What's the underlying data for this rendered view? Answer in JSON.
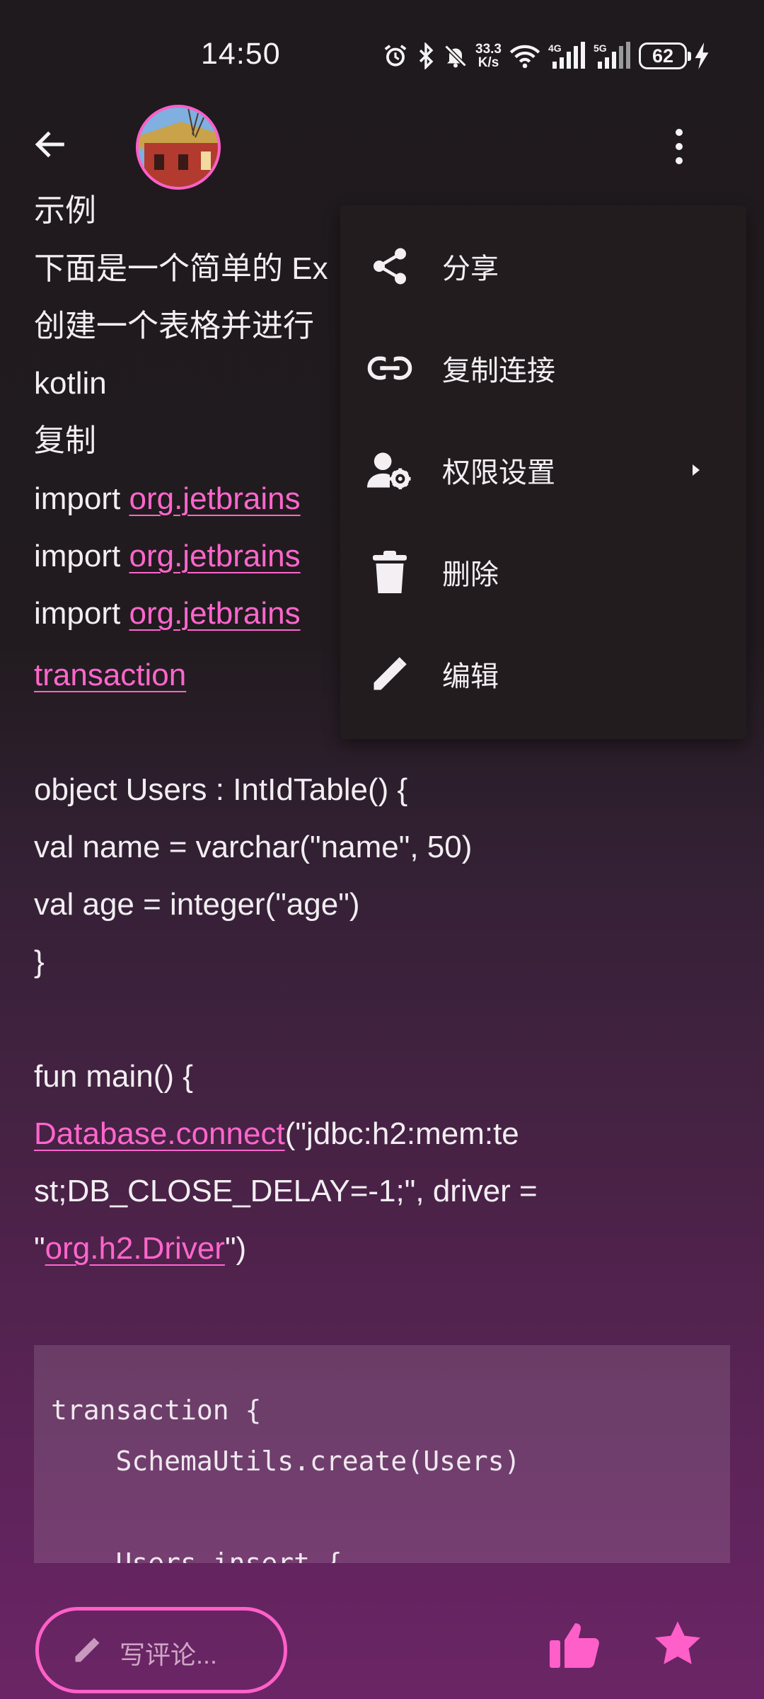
{
  "status_bar": {
    "time": "14:50",
    "net_speed_value": "33.3",
    "net_speed_unit": "K/s",
    "mobile_4g": "4G",
    "mobile_5g": "5G",
    "battery_level": "62"
  },
  "content": {
    "lines": {
      "l1": "示例",
      "l2": "下面是一个简单的 Ex",
      "l3": "创建一个表格并进行",
      "l4": "kotlin",
      "l5": "复制",
      "import_kw": "import ",
      "import_link": "org.jetbrains",
      "transaction": "transaction",
      "obj1": "object Users : IntIdTable() {",
      "obj2": "val name = varchar(\"name\", 50)",
      "obj3": "val age = integer(\"age\")",
      "obj4": "}",
      "fun1": "fun main() {",
      "db_link": "Database.connect",
      "db_rest": "(\"jdbc:h2:mem:te",
      "db2": "st;DB_CLOSE_DELAY=-1;\", driver =",
      "drv_open": "\"",
      "drv_link": "org.h2.Driver",
      "drv_close": "\")"
    },
    "code_block": [
      "transaction {",
      "    SchemaUtils.create(Users)",
      "",
      "    Users.insert {"
    ]
  },
  "menu": {
    "items": [
      {
        "label": "分享",
        "icon": "share-icon"
      },
      {
        "label": "复制连接",
        "icon": "link-icon"
      },
      {
        "label": "权限设置",
        "icon": "user-settings-icon"
      },
      {
        "label": "删除",
        "icon": "delete-icon"
      },
      {
        "label": "编辑",
        "icon": "edit-icon"
      }
    ]
  },
  "bottom_bar": {
    "comment_placeholder": "写评论..."
  },
  "colors": {
    "accent": "#ff5fc8",
    "link": "#ff66cc",
    "menu_bg": "#221c1f"
  }
}
